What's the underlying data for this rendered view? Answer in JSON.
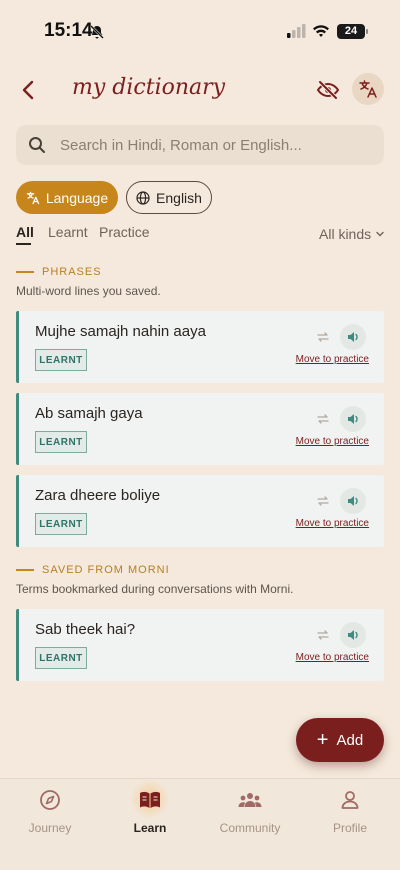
{
  "status": {
    "time": "15:14",
    "battery": "24"
  },
  "header": {
    "title": "my dictionary"
  },
  "search": {
    "placeholder": "Search in Hindi, Roman or English..."
  },
  "filters": {
    "language_chip": "Language",
    "english_chip": "English"
  },
  "tabs": [
    {
      "label": "All",
      "active": true
    },
    {
      "label": "Learnt",
      "active": false
    },
    {
      "label": "Practice",
      "active": false
    }
  ],
  "kinds": {
    "label": "All kinds"
  },
  "sections": [
    {
      "title": "PHRASES",
      "description": "Multi-word lines you saved.",
      "items": [
        {
          "text": "Mujhe samajh nahin aaya",
          "badge": "LEARNT",
          "action": "Move to practice"
        },
        {
          "text": "Ab samajh gaya",
          "badge": "LEARNT",
          "action": "Move to practice"
        },
        {
          "text": "Zara dheere boliye",
          "badge": "LEARNT",
          "action": "Move to practice"
        }
      ]
    },
    {
      "title": "SAVED FROM MORNI",
      "description": "Terms bookmarked during conversations with Morni.",
      "items": [
        {
          "text": "Sab theek hai?",
          "badge": "LEARNT",
          "action": "Move to practice"
        }
      ]
    }
  ],
  "add_button": {
    "label": "Add"
  },
  "nav": [
    {
      "label": "Journey",
      "icon": "compass-icon",
      "active": false
    },
    {
      "label": "Learn",
      "icon": "book-icon",
      "active": true
    },
    {
      "label": "Community",
      "icon": "people-icon",
      "active": false
    },
    {
      "label": "Profile",
      "icon": "person-icon",
      "active": false
    }
  ],
  "colors": {
    "background": "#f4e9dc",
    "accent": "#7b1e1e",
    "gold": "#c7861c",
    "teal": "#3f8b7e"
  }
}
